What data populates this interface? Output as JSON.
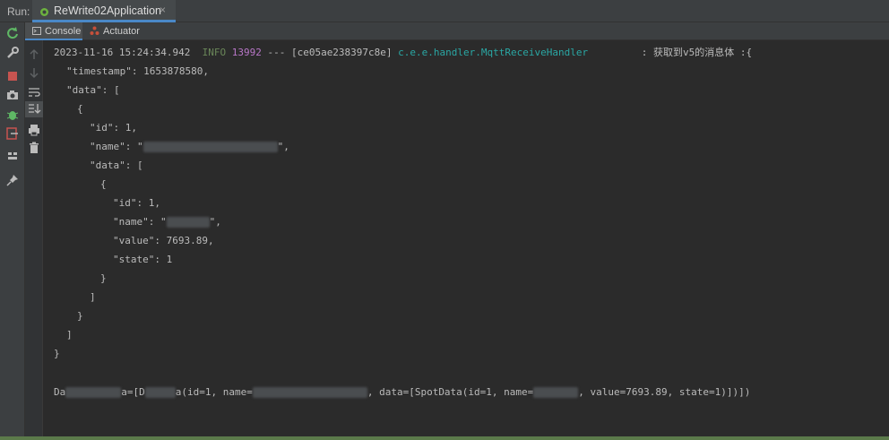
{
  "run": {
    "label": "Run:",
    "tab_title": "ReWrite02Application",
    "close_glyph": "×"
  },
  "tabs": [
    {
      "label": "Console",
      "icon": "console-icon",
      "active": true
    },
    {
      "label": "Actuator",
      "icon": "actuator-icon",
      "active": false
    }
  ],
  "toolbar_left": [
    "rerun-icon",
    "wrench-icon",
    "stop-icon",
    "camera-icon",
    "debug-icon",
    "exit-icon",
    "layout-icon",
    "pin-icon"
  ],
  "toolbar_second": [
    "up-arrow-icon",
    "down-arrow-icon",
    "soft-wrap-icon",
    "scroll-to-end-icon",
    "print-icon",
    "trash-icon"
  ],
  "log": {
    "timestamp": "2023-11-16 15:24:34.942",
    "level": "INFO",
    "pid": "13992",
    "sep": "---",
    "thread": "[ce05ae238397c8e]",
    "logger": "c.e.e.handler.MqttReceiveHandler",
    "message": ": 获取到v5的消息体 :{",
    "json_lines": [
      "\"timestamp\": 1653878580,",
      "\"data\": [",
      "{",
      "\"id\": 1,",
      "\"name\": \"",
      "\"data\": [",
      "{",
      "\"id\": 1,",
      "\"name\": \"",
      "\"value\": 7693.89,",
      "\"state\": 1",
      "}",
      "]",
      "}",
      "]",
      "}"
    ],
    "name_suffix_1": "\",",
    "name_suffix_2": "\",",
    "final_prefix": "Da",
    "final_a": "a=[D",
    "final_b": "a(id=1, name=",
    "final_c": ", data=[SpotData(id=1, name=",
    "final_d": ", value=7693.89, state=1)])])"
  },
  "colors": {
    "info": "#6a8759",
    "pid": "#b877c8",
    "logger": "#2aa7a4",
    "accent": "#4a88c7"
  }
}
